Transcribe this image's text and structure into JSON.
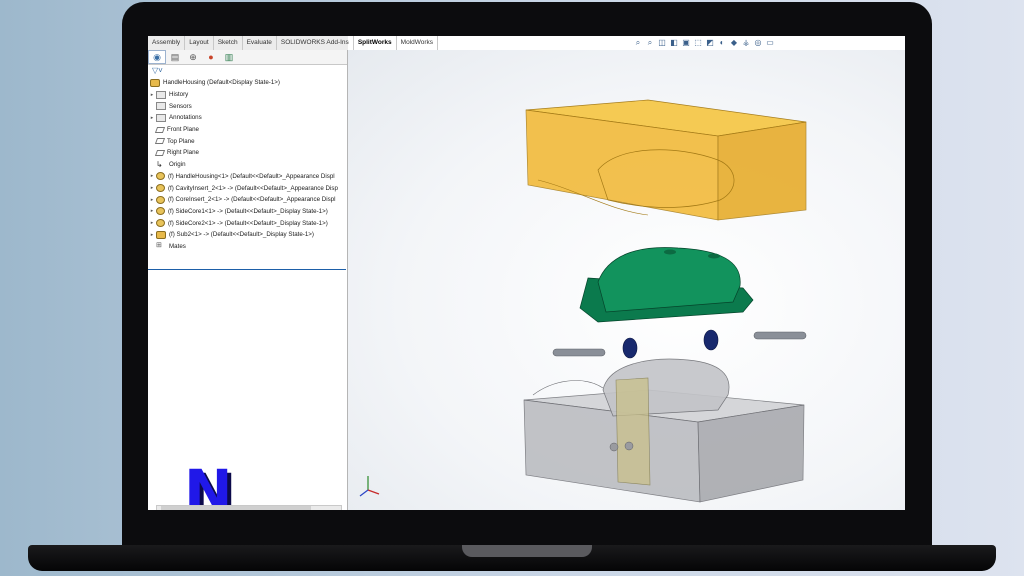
{
  "command_tabs": [
    "Assembly",
    "Layout",
    "Sketch",
    "Evaluate",
    "SOLIDWORKS Add-Ins",
    "SplitWorks",
    "MoldWorks"
  ],
  "active_tab_index": 5,
  "fm_tabs": [
    "feature-manager-icon",
    "property-manager-icon",
    "configuration-manager-icon",
    "appearance-icon",
    "display-manager-icon"
  ],
  "tree": {
    "root": "HandleHousing  (Default<Display State-1>)",
    "items": [
      {
        "label": "History",
        "icon": "folder",
        "expand": true
      },
      {
        "label": "Sensors",
        "icon": "folder",
        "expand": false
      },
      {
        "label": "Annotations",
        "icon": "folder",
        "expand": true
      },
      {
        "label": "Front Plane",
        "icon": "plane",
        "expand": false
      },
      {
        "label": "Top Plane",
        "icon": "plane",
        "expand": false
      },
      {
        "label": "Right Plane",
        "icon": "plane",
        "expand": false
      },
      {
        "label": "Origin",
        "icon": "origin",
        "expand": false
      },
      {
        "label": "(f) HandleHousing<1> (Default<<Default>_Appearance Displ",
        "icon": "part",
        "expand": true
      },
      {
        "label": "(f) CavityInsert_2<1> -> (Default<<Default>_Appearance Disp",
        "icon": "part",
        "expand": true
      },
      {
        "label": "(f) CoreInsert_2<1> -> (Default<<Default>_Appearance Displ",
        "icon": "part",
        "expand": true
      },
      {
        "label": "(f) SideCore1<1> -> (Default<<Default>_Display State-1>)",
        "icon": "part",
        "expand": true
      },
      {
        "label": "(f) SideCore2<1> -> (Default<<Default>_Display State-1>)",
        "icon": "part",
        "expand": true
      },
      {
        "label": "(f) Sub2<1> -> (Default<<Default>_Display State-1>)",
        "icon": "assy",
        "expand": true
      },
      {
        "label": "Mates",
        "icon": "mates",
        "expand": false
      }
    ]
  },
  "logo_letter": "N",
  "hud_icons": [
    "zoom-to-fit-icon",
    "zoom-area-icon",
    "previous-view-icon",
    "section-view-icon",
    "dynamic-annotation-icon",
    "view-orientation-icon",
    "display-style-icon",
    "hide-show-icon",
    "edit-appearance-icon",
    "apply-scene-icon",
    "view-settings-icon",
    "display-pane-icon"
  ],
  "colors": {
    "cavity": "#f2b730",
    "part": "#0e8a58",
    "core": "#a9a9ad",
    "pins": "#8a8f98",
    "accent": "#1d5fa8"
  }
}
